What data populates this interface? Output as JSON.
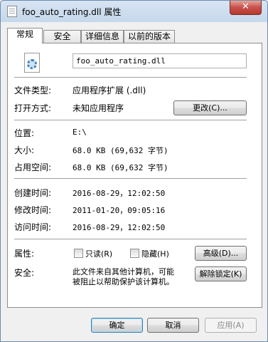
{
  "window": {
    "title": "foo_auto_rating.dll 属性",
    "close_glyph": "✕",
    "icon": "file-icon"
  },
  "tabs": [
    {
      "label": "常规",
      "active": true
    },
    {
      "label": "安全",
      "active": false
    },
    {
      "label": "详细信息",
      "active": false
    },
    {
      "label": "以前的版本",
      "active": false
    }
  ],
  "general": {
    "file_icon": "dll-gear-icon",
    "file_name": "foo_auto_rating.dll",
    "file_type_label": "文件类型:",
    "file_type_value": "应用程序扩展 (.dll)",
    "opens_with_label": "打开方式:",
    "opens_with_value": "未知应用程序",
    "change_button": "更改(C)...",
    "location_label": "位置:",
    "location_value": "E:\\",
    "size_label": "大小:",
    "size_value": "68.0 KB (69,632 字节)",
    "size_on_disk_label": "占用空间:",
    "size_on_disk_value": "68.0 KB (69,632 字节)",
    "created_label": "创建时间:",
    "created_value": "2016-08-29，12:02:50",
    "modified_label": "修改时间:",
    "modified_value": "2011-01-20，09:05:16",
    "accessed_label": "访问时间:",
    "accessed_value": "2016-08-29，12:02:50",
    "attributes_label": "属性:",
    "readonly_label": "只读(R)",
    "hidden_label": "隐藏(H)",
    "advanced_button": "高级(D)...",
    "security_label": "安全:",
    "security_text_line1": "此文件来自其他计算机，可能",
    "security_text_line2": "被阻止以帮助保护该计算机。",
    "unblock_button": "解除锁定(K)"
  },
  "footer": {
    "ok_button": "确定",
    "cancel_button": "取消",
    "apply_button": "应用(A)"
  }
}
